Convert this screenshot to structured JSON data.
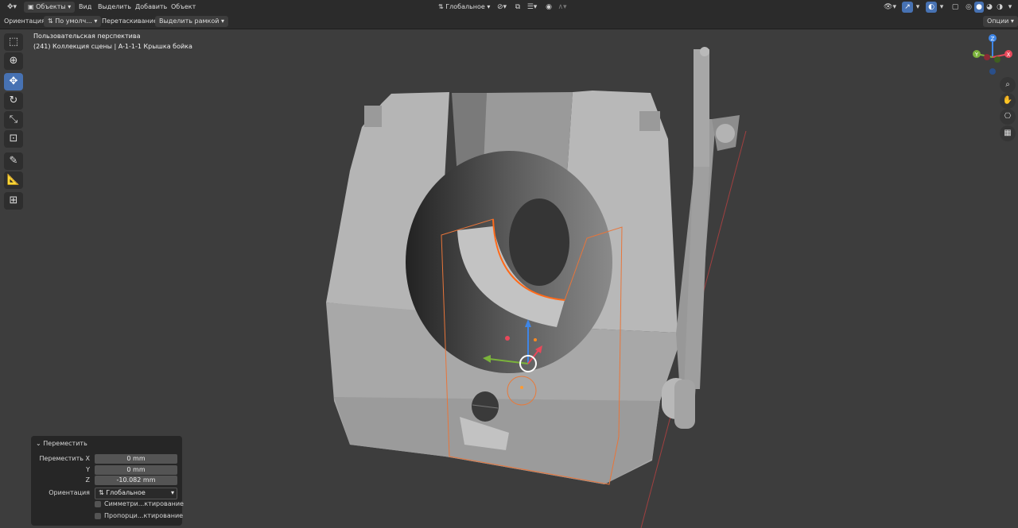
{
  "header": {
    "mode_label": "Объекты",
    "menu": [
      "Вид",
      "Выделить",
      "Добавить",
      "Объект"
    ],
    "transform_orientation": "Глобальное",
    "options_label": "Опции"
  },
  "tool_header": {
    "orientation_label": "Ориентация:",
    "orientation_value": "По умолч...",
    "drag_label": "Перетаскивание:",
    "drag_value": "Выделить рамкой"
  },
  "viewport": {
    "perspective_text": "Пользовательская перспектива",
    "collection_text": "(241) Коллекция сцены | A-1-1-1 Крышка бойка",
    "gizmo": {
      "x": "X",
      "y": "Y",
      "z": "Z"
    }
  },
  "operator_panel": {
    "title": "Переместить",
    "rows": [
      {
        "label": "Переместить X",
        "value": "0 mm"
      },
      {
        "label": "Y",
        "value": "0 mm"
      },
      {
        "label": "Z",
        "value": "-10.082 mm"
      }
    ],
    "orientation_label": "Ориентация",
    "orientation_value": "Глобальное",
    "checkbox1": "Симметри...ктирование",
    "checkbox2": "Пропорци...ктирование"
  },
  "colors": {
    "accent": "#4772b3",
    "selection": "#e8753a",
    "axis_x": "#e8485a",
    "axis_y": "#7bb33b",
    "axis_z": "#3f86e6"
  }
}
